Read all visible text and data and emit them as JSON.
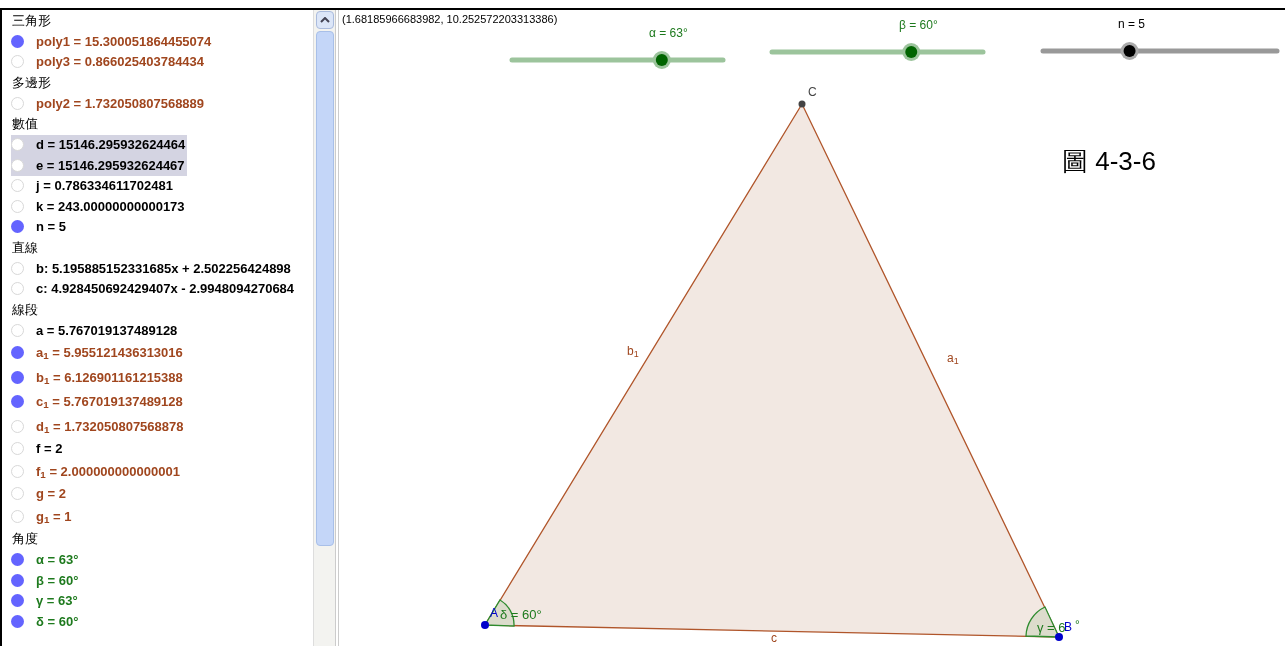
{
  "algebra": [
    {
      "kind": "header",
      "text": "三角形"
    },
    {
      "kind": "item",
      "text": "poly1 = 15.300051864455074",
      "visible": true,
      "selected": false,
      "color": "#a0461e"
    },
    {
      "kind": "item",
      "text": "poly3 = 0.866025403784434",
      "visible": false,
      "selected": false,
      "color": "#a0461e"
    },
    {
      "kind": "header",
      "text": "多邊形"
    },
    {
      "kind": "item",
      "text": "poly2 = 1.732050807568889",
      "visible": false,
      "selected": false,
      "color": "#a0461e"
    },
    {
      "kind": "header",
      "text": "數值"
    },
    {
      "kind": "item",
      "text": "d = 15146.295932624464",
      "visible": false,
      "selected": true,
      "color": "#000000"
    },
    {
      "kind": "item",
      "text": "e = 15146.295932624467",
      "visible": false,
      "selected": true,
      "color": "#000000"
    },
    {
      "kind": "item",
      "text": "j = 0.786334611702481",
      "visible": false,
      "selected": false,
      "color": "#000000"
    },
    {
      "kind": "item",
      "text": "k = 243.00000000000173",
      "visible": false,
      "selected": false,
      "color": "#000000"
    },
    {
      "kind": "item",
      "text": "n = 5",
      "visible": true,
      "selected": false,
      "color": "#000000"
    },
    {
      "kind": "header",
      "text": "直線"
    },
    {
      "kind": "item",
      "text": "b: 5.195885152331685x + 2.502256424898",
      "visible": false,
      "selected": false,
      "color": "#000000"
    },
    {
      "kind": "item",
      "text": "c: 4.928450692429407x - 2.9948094270684",
      "visible": false,
      "selected": false,
      "color": "#000000"
    },
    {
      "kind": "header",
      "text": "線段"
    },
    {
      "kind": "item",
      "text": "a = 5.767019137489128",
      "visible": false,
      "selected": false,
      "color": "#000000"
    },
    {
      "kind": "item",
      "text": "a$_{1}$ = 5.955121436313016",
      "visible": true,
      "selected": false,
      "color": "#a0461e"
    },
    {
      "kind": "item",
      "text": "b$_{1}$ = 6.126901161215388",
      "visible": true,
      "selected": false,
      "color": "#a0461e"
    },
    {
      "kind": "item",
      "text": "c$_{1}$ = 5.767019137489128",
      "visible": true,
      "selected": false,
      "color": "#a0461e"
    },
    {
      "kind": "item",
      "text": "d$_{1}$ = 1.732050807568878",
      "visible": false,
      "selected": false,
      "color": "#a0461e"
    },
    {
      "kind": "item",
      "text": "f = 2",
      "visible": false,
      "selected": false,
      "color": "#000000"
    },
    {
      "kind": "item",
      "text": "f$_{1}$ = 2.000000000000001",
      "visible": false,
      "selected": false,
      "color": "#a0461e"
    },
    {
      "kind": "item",
      "text": "g = 2",
      "visible": false,
      "selected": false,
      "color": "#a0461e"
    },
    {
      "kind": "item",
      "text": "g$_{1}$ = 1",
      "visible": false,
      "selected": false,
      "color": "#a0461e"
    },
    {
      "kind": "header",
      "text": "角度"
    },
    {
      "kind": "item",
      "text": "α = 63°",
      "visible": true,
      "selected": false,
      "color": "#1e7a1e"
    },
    {
      "kind": "item",
      "text": "β = 60°",
      "visible": true,
      "selected": false,
      "color": "#1e7a1e"
    },
    {
      "kind": "item",
      "text": "γ = 63°",
      "visible": true,
      "selected": false,
      "color": "#1e7a1e"
    },
    {
      "kind": "item",
      "text": "δ = 60°",
      "visible": true,
      "selected": false,
      "color": "#1e7a1e"
    }
  ],
  "canvas": {
    "coordinates": "(1.68185966683982, 10.252572203313386)",
    "caption": "圖 4-3-6",
    "sliders": [
      {
        "label": "α = 63°",
        "level": 0.71,
        "color": "#1e7a1e"
      },
      {
        "label": "β = 60°",
        "level": 0.66,
        "color": "#1e7a1e"
      },
      {
        "label": "n = 5",
        "level": 0.37,
        "color": "#000000"
      }
    ],
    "points": [
      {
        "label": "A",
        "color": "#0000cc"
      },
      {
        "label": "B",
        "color": "#0000cc"
      },
      {
        "label": "C",
        "color": "#444444"
      }
    ],
    "segment_labels": [
      "b$_{1}$",
      "a$_{1}$",
      "c"
    ],
    "angle_labels": [
      "δ = 60°",
      "γ = 6"
    ],
    "angle_label_tail": "°"
  }
}
